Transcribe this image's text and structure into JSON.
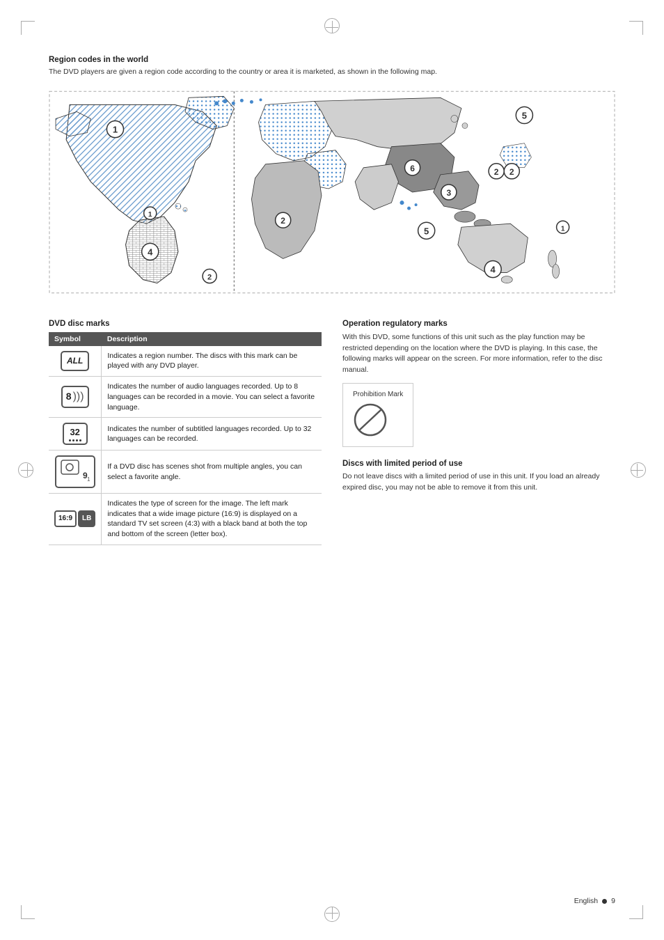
{
  "page": {
    "language": "English",
    "page_number": "9"
  },
  "region_codes": {
    "title": "Region codes in the world",
    "description": "The DVD players are given a region code according to the country or area it is marketed, as shown in the following map."
  },
  "dvd_disc_marks": {
    "title": "DVD disc marks",
    "table": {
      "col_symbol": "Symbol",
      "col_description": "Description",
      "rows": [
        {
          "symbol": "ALL",
          "description": "Indicates a region number. The discs with this mark can be played with any DVD player."
        },
        {
          "symbol": "8",
          "description": "Indicates the number of audio languages recorded. Up to 8 languages can be recorded in a movie. You can select a favorite language."
        },
        {
          "symbol": "32",
          "description": "Indicates the number of subtitled languages recorded. Up to 32 languages can be recorded."
        },
        {
          "symbol": "9",
          "description": "If a DVD disc has scenes shot from multiple angles, you can select a favorite angle."
        },
        {
          "symbol": "16:9 LB",
          "description": "Indicates the type of screen for the image. The left mark indicates that a wide image picture (16:9) is displayed on a standard TV set screen (4:3) with a black band at both the top and bottom of the screen (letter box)."
        }
      ]
    }
  },
  "operation_regulatory": {
    "title": "Operation regulatory marks",
    "description": "With this DVD, some functions of this unit such as the play function may be restricted depending on the location where the DVD is playing. In this case, the following marks will appear on the screen. For more information, refer to the disc manual.",
    "prohibition_mark_label": "Prohibition Mark"
  },
  "discs_limited": {
    "title": "Discs with limited period of use",
    "description": "Do not leave discs with a limited period of use in this unit. If you load an already expired disc, you may not be able to remove it from this unit."
  }
}
